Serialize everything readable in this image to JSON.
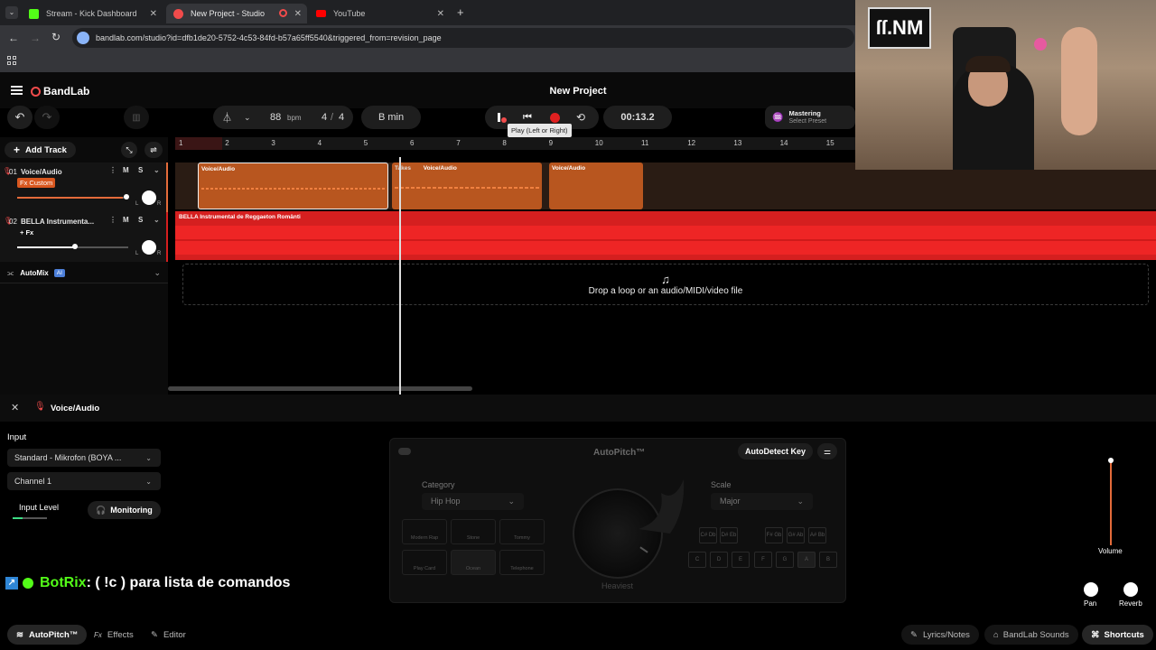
{
  "browser": {
    "tabs": [
      {
        "label": "Stream - Kick Dashboard",
        "color": "#53fc18"
      },
      {
        "label": "New Project - Studio",
        "color": "#f14b4b"
      },
      {
        "label": "YouTube",
        "color": "#ff0000"
      }
    ],
    "url": "bandlab.com/studio?id=dfb1de20-5752-4c53-84fd-b57a65ff5540&triggered_from=revision_page"
  },
  "app": {
    "logo": "BandLab",
    "title": "New Project",
    "accent": "#f14b4b"
  },
  "toolbar": {
    "bpm_value": "88",
    "bpm_unit": "bpm",
    "time_sig_num": "4",
    "time_sig_sep": "/",
    "time_sig_den": "4",
    "key": "B min",
    "time": "00:13.2",
    "tooltip": "Play (Left or Right)",
    "mastering_title": "Mastering",
    "mastering_sub": "Select Preset"
  },
  "tracks_panel": {
    "add_track": "Add Track",
    "tracks": [
      {
        "num": "01",
        "name": "Voice/Audio",
        "fx": "Fx Custom",
        "m": "M",
        "s": "S",
        "volume": 0.95
      },
      {
        "num": "02",
        "name": "BELLA Instrumenta...",
        "fx": "+ Fx",
        "m": "M",
        "s": "S",
        "volume": 0.5
      }
    ],
    "automix": "AutoMix",
    "automix_badge": "AI",
    "pan_l": "L",
    "pan_r": "R"
  },
  "ruler": [
    "1",
    "2",
    "3",
    "4",
    "5",
    "6",
    "7",
    "8",
    "9",
    "10",
    "11",
    "12",
    "13",
    "14",
    "15"
  ],
  "clips": {
    "voice_clip_label": "Voice/Audio",
    "takes_label": "Takes",
    "instrumental_label": "BELLA Instrumental de Reggaeton Românti"
  },
  "drop_zone": "Drop a loop or an audio/MIDI/video file",
  "panel": {
    "title": "Voice/Audio",
    "input_label": "Input",
    "input_device": "Standard - Mikrofon (BOYA ...",
    "channel": "Channel 1",
    "input_level": "Input Level",
    "monitoring": "Monitoring"
  },
  "autopitch": {
    "title": "AutoPitch™",
    "autodetect": "AutoDetect Key",
    "category_label": "Category",
    "category_value": "Hip Hop",
    "scale_label": "Scale",
    "scale_value": "Major",
    "knob_label": "Heaviest",
    "styles": [
      "Modern Rap",
      "Stone",
      "Tommy",
      "Play Card",
      "Ocean",
      "Telephone"
    ],
    "sharps": [
      "C# Db",
      "D# Eb",
      "F# Gb",
      "G# Ab",
      "A# Bb"
    ],
    "naturals": [
      "C",
      "D",
      "E",
      "F",
      "G",
      "A",
      "B"
    ]
  },
  "mixer": {
    "volume": "Volume",
    "pan": "Pan",
    "reverb": "Reverb"
  },
  "chat": {
    "name": "BotRix",
    "message": " : ( !c ) para lista de comandos",
    "name_color": "#53fc18"
  },
  "bottom_tabs": {
    "autopitch": "AutoPitch™",
    "effects": "Effects",
    "editor": "Editor",
    "lyrics": "Lyrics/Notes",
    "sounds": "BandLab Sounds",
    "shortcuts": "Shortcuts"
  },
  "webcam": {
    "sign": "ſſ.NM"
  }
}
